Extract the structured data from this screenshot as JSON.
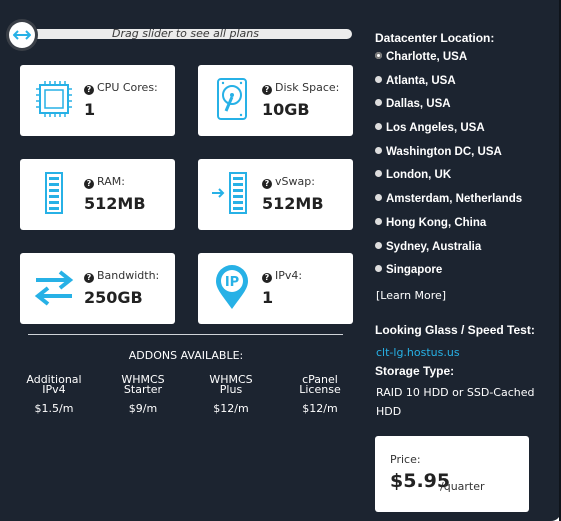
{
  "slider": {
    "hint": "Drag slider to see all plans"
  },
  "specs": [
    {
      "label": "CPU Cores:",
      "value": "1",
      "icon": "cpu-icon"
    },
    {
      "label": "Disk Space:",
      "value": "10GB",
      "icon": "hard-disk-icon"
    },
    {
      "label": "RAM:",
      "value": "512MB",
      "icon": "ram-icon"
    },
    {
      "label": "vSwap:",
      "value": "512MB",
      "icon": "vswap-icon"
    },
    {
      "label": "Bandwidth:",
      "value": "250GB",
      "icon": "bandwidth-icon"
    },
    {
      "label": "IPv4:",
      "value": "1",
      "icon": "ip-pin-icon"
    }
  ],
  "addons": {
    "title": "ADDONS AVAILABLE:",
    "items": [
      {
        "line1": "Additional",
        "line2": "IPv4",
        "price": "$1.5/m"
      },
      {
        "line1": "WHMCS",
        "line2": "Starter",
        "price": "$9/m"
      },
      {
        "line1": "WHMCS",
        "line2": "Plus",
        "price": "$12/m"
      },
      {
        "line1": "cPanel",
        "line2": "License",
        "price": "$12/m"
      }
    ]
  },
  "datacenter": {
    "title": "Datacenter Location:",
    "locations": [
      "Charlotte, USA",
      "Atlanta, USA",
      "Dallas, USA",
      "Los Angeles, USA",
      "Washington DC, USA",
      "London, UK",
      "Amsterdam, Netherlands",
      "Hong Kong, China",
      "Sydney, Australia",
      "Singapore"
    ],
    "selected": "Charlotte, USA",
    "learn_more": "[Learn More]"
  },
  "looking_glass": {
    "title": "Looking Glass / Speed Test:",
    "link": "clt-lg.hostus.us"
  },
  "storage": {
    "title": "Storage Type:",
    "value": "RAID 10 HDD or SSD-Cached HDD"
  },
  "price": {
    "label": "Price:",
    "amount": "$5.95",
    "period": "/quarter"
  },
  "colors": {
    "panel": "#1c2430",
    "accent": "#27b1e6",
    "card": "#ffffff"
  }
}
